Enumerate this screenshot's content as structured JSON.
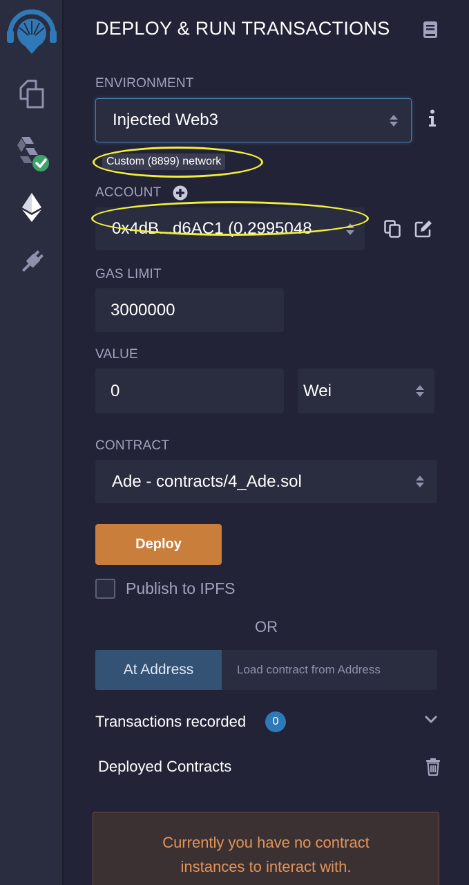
{
  "sidebar": {
    "icons": [
      "remix-logo-icon",
      "file-explorer-icon",
      "solidity-compiler-icon",
      "deploy-run-icon",
      "plugin-manager-icon"
    ],
    "colors": {
      "rail_bg": "#2a2c3f",
      "logo_blue": "#2f79b7",
      "check_green": "#3ea36a"
    }
  },
  "panel": {
    "title": "DEPLOY & RUN TRANSACTIONS",
    "environment": {
      "label": "ENVIRONMENT",
      "selected": "Injected Web3",
      "network_badge": "Custom (8899) network"
    },
    "account": {
      "label": "ACCOUNT",
      "selected": "0x4dB...d6AC1 (0.2995048"
    },
    "gas_limit": {
      "label": "GAS LIMIT",
      "value": "3000000"
    },
    "value": {
      "label": "VALUE",
      "amount": "0",
      "unit": "Wei"
    },
    "contract": {
      "label": "CONTRACT",
      "selected": "Ade - contracts/4_Ade.sol"
    },
    "deploy_label": "Deploy",
    "publish_ipfs_label": "Publish to IPFS",
    "or_label": "OR",
    "at_address": {
      "button_label": "At Address",
      "placeholder": "Load contract from Address"
    },
    "transactions": {
      "label": "Transactions recorded",
      "count": "0"
    },
    "deployed_contracts_label": "Deployed Contracts",
    "notice_line1": "Currently you have no contract",
    "notice_line2": "instances to interact with.",
    "colors": {
      "accent_deploy": "#c97e3c",
      "at_address_bg": "#345274",
      "highlight_ellipse": "#f1ef3a",
      "notice_text": "#e1955b"
    }
  }
}
